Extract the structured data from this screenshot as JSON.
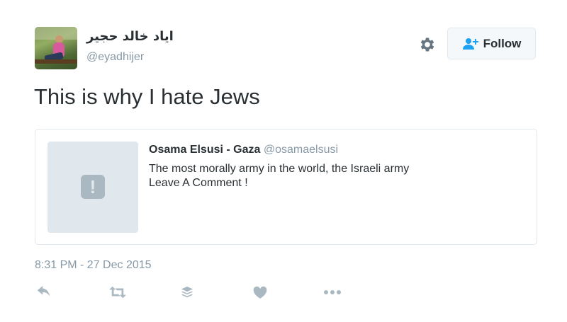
{
  "user": {
    "display_name": "اياد خالد حجير",
    "handle": "@eyadhijer",
    "avatar_icon": "profile-photo"
  },
  "header": {
    "settings_icon": "gear-icon",
    "follow_label": "Follow",
    "follow_icon": "user-plus-icon"
  },
  "tweet": {
    "text": "This is why I hate Jews",
    "timestamp": "8:31 PM - 27 Dec 2015"
  },
  "quoted": {
    "name": "Osama Elsusi - Gaza",
    "handle": "@osamaelsusi",
    "line1": "The most morally army in the world, the Israeli army",
    "line2": "Leave A Comment !",
    "thumb_icon": "warning-icon",
    "thumb_symbol": "!"
  },
  "actions": [
    {
      "icon": "reply-icon"
    },
    {
      "icon": "retweet-icon"
    },
    {
      "icon": "buffer-stack-icon"
    },
    {
      "icon": "heart-icon"
    },
    {
      "icon": "more-icon"
    }
  ],
  "colors": {
    "text": "#292f33",
    "muted": "#8899a6",
    "border": "#e1e8ed",
    "icon": "#aab8c2",
    "follow_icon": "#1da1f2"
  }
}
